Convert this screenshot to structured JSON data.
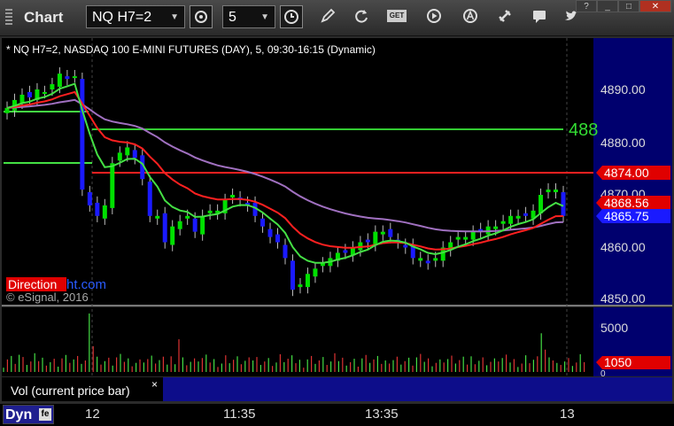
{
  "window": {
    "title": "Chart"
  },
  "toolbar": {
    "symbol": "NQ H7=2",
    "interval": "5",
    "get_icon_text": "GET",
    "buttons": [
      "symbol-settings-icon",
      "interval-clock-icon",
      "draw-pencil-icon",
      "refresh-icon",
      "play-icon",
      "text-icon",
      "tools-icon",
      "chat-icon",
      "twitter-icon"
    ]
  },
  "window_controls": [
    "?",
    "_",
    "□",
    "✕"
  ],
  "chart": {
    "header": "* NQ H7=2, NASDAQ 100 E-MINI FUTURES (DAY), 5, 09:30-16:15 (Dynamic)",
    "watermark_brand": "Direction",
    "watermark_brand_suffix": "ht.com",
    "copyright": "© eSignal, 2016",
    "level_label": "488",
    "price_ticks": [
      "4890.00",
      "4880.00",
      "4870.00",
      "4860.00",
      "4850.00"
    ],
    "price_badges": {
      "red_top": "4874.00",
      "red_mid": "4868.56",
      "blue": "4865.75"
    },
    "volume_ticks": [
      "5000",
      "0"
    ],
    "volume_badge": "1050",
    "volume_label": "Vol (current price bar)",
    "volume_close": "×",
    "x_labels": [
      "12",
      "11:35",
      "13:35",
      "13"
    ],
    "dyn_label": "Dyn",
    "colors": {
      "up": "#00e000",
      "down": "#1a1aff",
      "ema_green": "#44e044",
      "red_line": "#ff2020",
      "vwap": "#a070c0",
      "level_green": "#33cc33",
      "bg": "#000000",
      "axis_bg": "#00006e"
    }
  },
  "chart_data": [
    {
      "type": "line",
      "title": "* NQ H7=2, NASDAQ 100 E-MINI FUTURES (DAY), 5, 09:30-16:15 (Dynamic)",
      "ylim": [
        4847,
        4897
      ],
      "yticks": [
        4850,
        4860,
        4870,
        4880,
        4890
      ],
      "x": [
        "12",
        "11:35",
        "13:35",
        "13"
      ],
      "horizontal_lines": [
        {
          "value": 4882.5,
          "label": "488",
          "color": "#33cc33"
        },
        {
          "value": 4874.0,
          "label": "4874.00",
          "color": "#ff2020"
        }
      ],
      "last_values": {
        "red_average": 4868.56,
        "last_price": 4865.75
      },
      "candles_close": [
        4886.5,
        4888,
        4889,
        4888.5,
        4890,
        4889.5,
        4891,
        4893,
        4892,
        4892.5,
        4871,
        4868,
        4866,
        4868,
        4876,
        4878,
        4879,
        4877,
        4873,
        4866,
        4866,
        4861,
        4864,
        4865,
        4866,
        4863,
        4866,
        4867,
        4867,
        4869,
        4870,
        4869,
        4868,
        4866,
        4864,
        4862,
        4861,
        4858,
        4852,
        4853,
        4855,
        4856,
        4857,
        4858,
        4859,
        4859,
        4860,
        4861,
        4861,
        4863,
        4863,
        4862,
        4861,
        4860,
        4858,
        4858,
        4857,
        4858,
        4860,
        4861,
        4862,
        4862,
        4863,
        4863,
        4864,
        4864,
        4865,
        4866,
        4866,
        4866,
        4867,
        4870,
        4871,
        4871,
        4866
      ]
    },
    {
      "type": "bar",
      "title": "Vol (current price bar)",
      "ylim": [
        0,
        7000
      ],
      "yticks": [
        0,
        5000
      ],
      "last_value": 1050
    }
  ]
}
